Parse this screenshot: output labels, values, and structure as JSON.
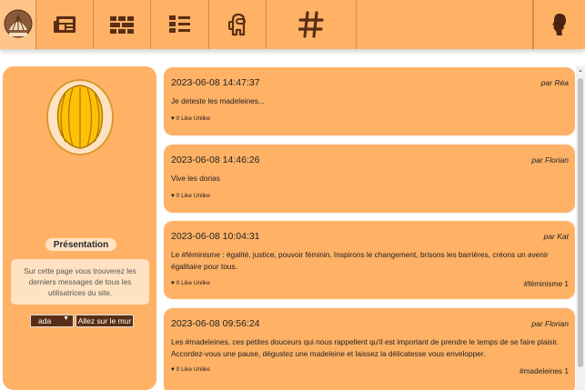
{
  "colors": {
    "nav_background": "#ffb165",
    "icon_color": "#5a2e14",
    "panel_background": "#ffb165",
    "light_box": "#ffe2c2",
    "madeleine_yellow": "#ffc107"
  },
  "nav": {
    "items": [
      {
        "icon": "madeleine-logo-icon"
      },
      {
        "icon": "newspaper-icon"
      },
      {
        "icon": "brick-wall-icon"
      },
      {
        "icon": "list-icon"
      },
      {
        "icon": "ghost-character-icon"
      },
      {
        "icon": "hashtag-icon"
      },
      {
        "icon": "profile-silhouette-icon"
      }
    ]
  },
  "sidebar": {
    "title": "Présentation",
    "description": "Sur cette page vous trouverez les derniers messages de tous les utilisatrices du site.",
    "user_select_value": "ada",
    "wall_button_label": "Allez sur le mur"
  },
  "posts": [
    {
      "date": "2023-06-08 14:47:37",
      "author": "par Réa",
      "text": "Je deteste les madeleines...",
      "likes": "♥ 0 Like Unlike",
      "tag": ""
    },
    {
      "date": "2023-06-08 14:46:26",
      "author": "par Florian",
      "text": "Vive les dorias",
      "likes": "♥ 0 Like Unlike",
      "tag": ""
    },
    {
      "date": "2023-06-08 10:04:31",
      "author": "par Kat",
      "text": "Le #féminisme : égalité, justice, pouvoir féminin. Inspirons le changement, brisons les barrières, créons un avenir égalitaire pour tous.",
      "likes": "♥ 0 Like Unlike",
      "tag": "#féminisme 1"
    },
    {
      "date": "2023-06-08 09:56:24",
      "author": "par Florian",
      "text": "Les #madeleines, ces petites douceurs qui nous rappellent qu'il est important de prendre le temps de se faire plaisir. Accordez-vous une pause, dégustez une madeleine et laissez la délicatesse vous envelopper.",
      "likes": "♥ 0 Like Unlike",
      "tag": "#madeleines 1"
    }
  ]
}
